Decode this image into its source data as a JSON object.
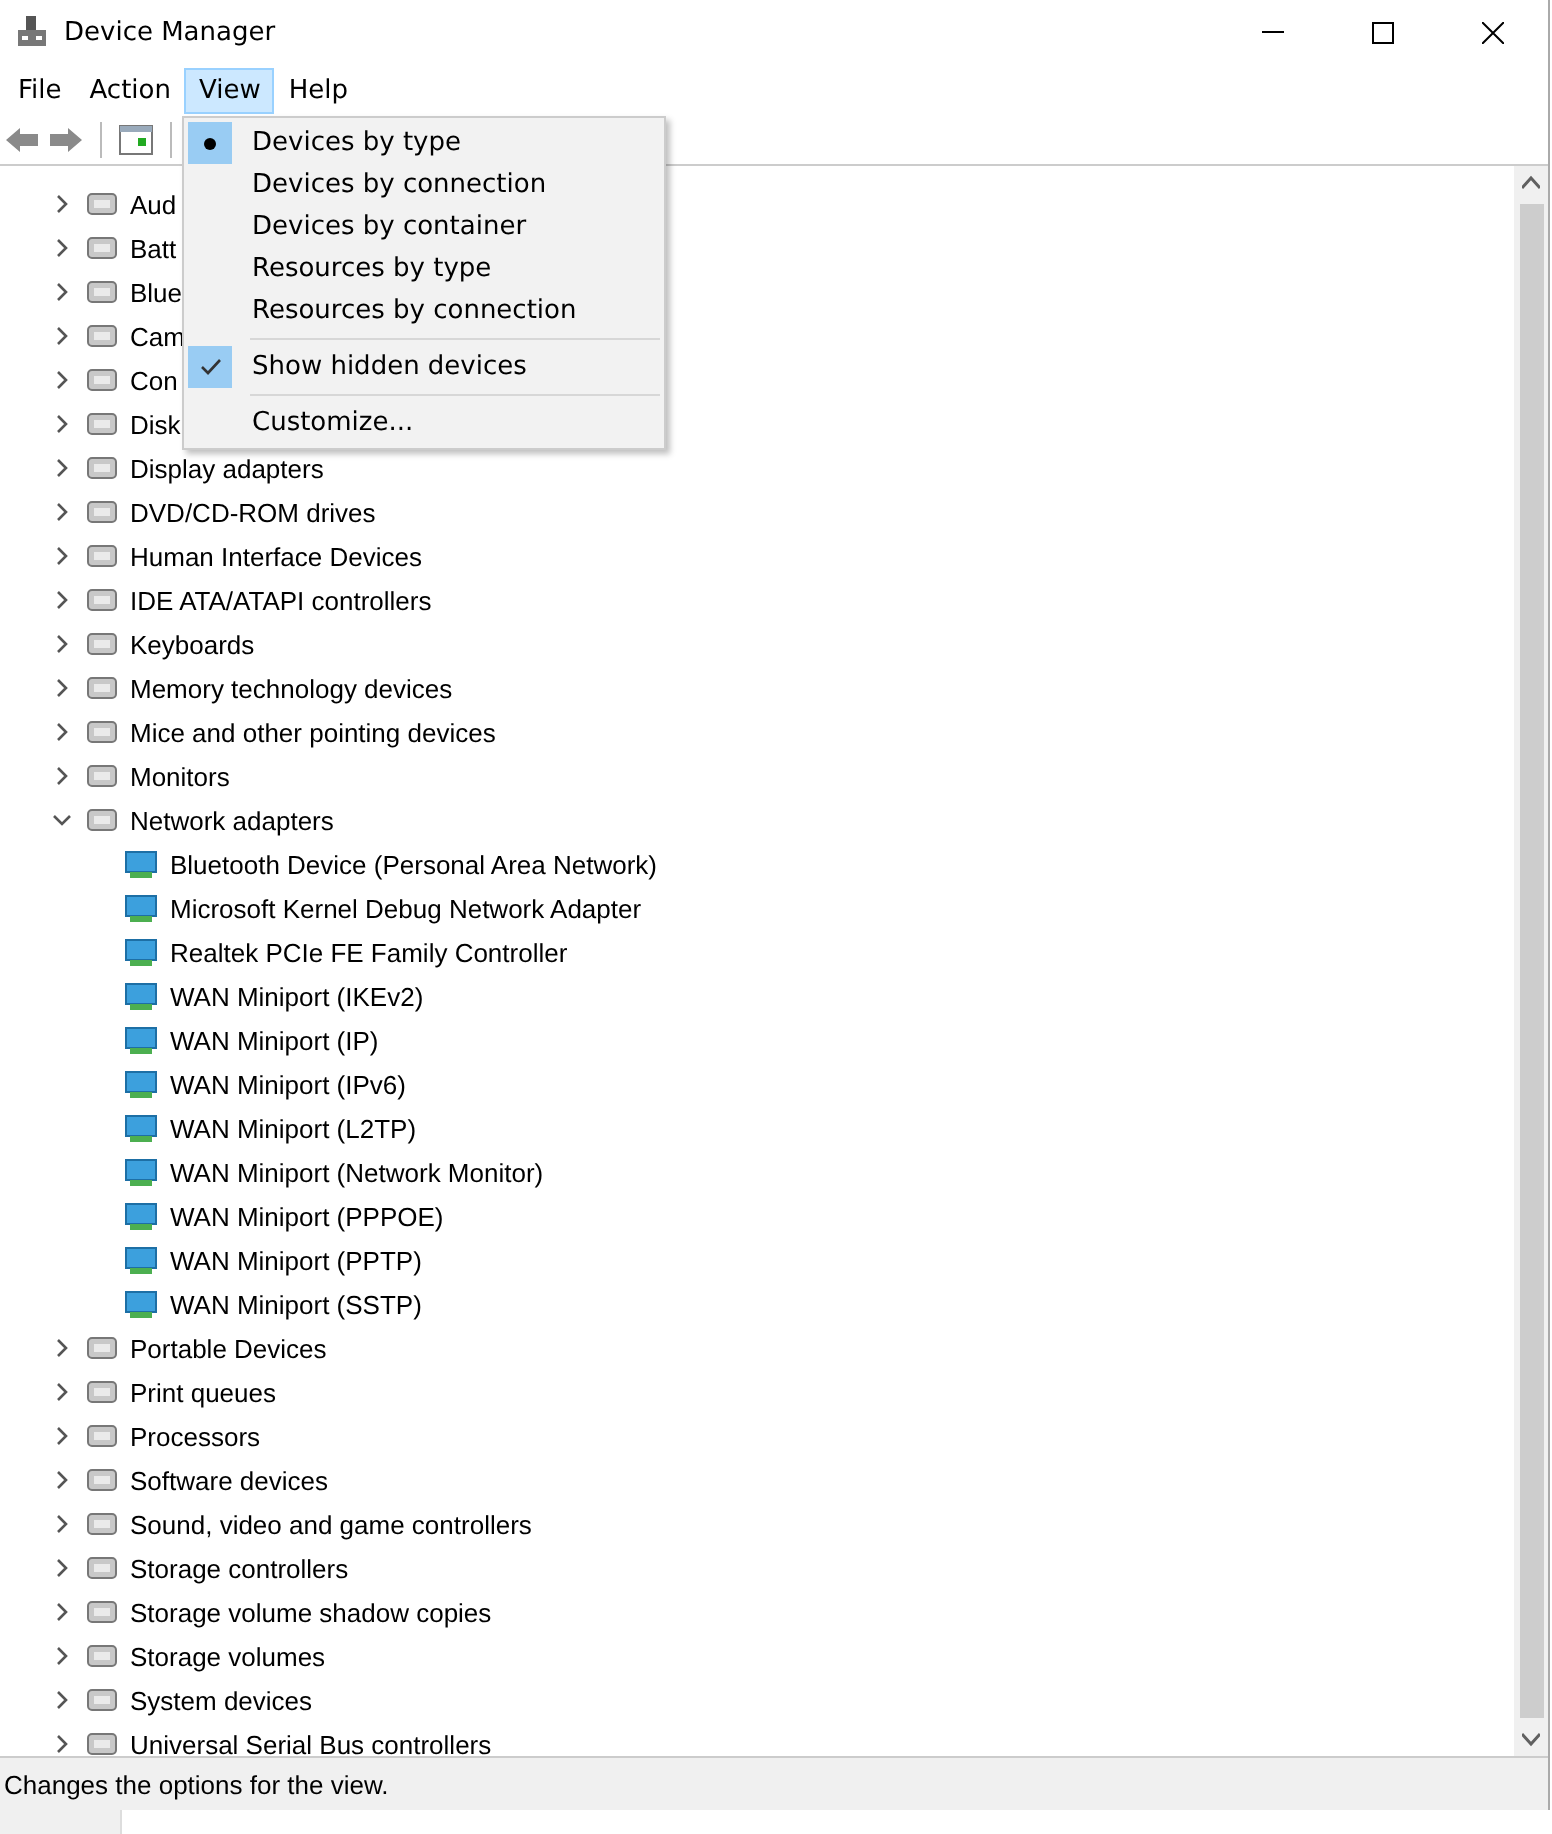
{
  "window": {
    "title": "Device Manager"
  },
  "menu_bar": [
    {
      "label": "File",
      "selected": false
    },
    {
      "label": "Action",
      "selected": false
    },
    {
      "label": "View",
      "selected": true
    },
    {
      "label": "Help",
      "selected": false
    }
  ],
  "view_menu": [
    {
      "kind": "radio",
      "label": "Devices by type",
      "checked": true
    },
    {
      "kind": "radio",
      "label": "Devices by connection",
      "checked": false
    },
    {
      "kind": "radio",
      "label": "Devices by container",
      "checked": false
    },
    {
      "kind": "radio",
      "label": "Resources by type",
      "checked": false
    },
    {
      "kind": "radio",
      "label": "Resources by connection",
      "checked": false
    },
    {
      "kind": "separator"
    },
    {
      "kind": "check",
      "label": "Show hidden devices",
      "checked": true
    },
    {
      "kind": "separator"
    },
    {
      "kind": "command",
      "label": "Customize..."
    }
  ],
  "tree": [
    {
      "label": "Aud",
      "expanded": false
    },
    {
      "label": "Batt",
      "expanded": false
    },
    {
      "label": "Blue",
      "expanded": false
    },
    {
      "label": "Cam",
      "expanded": false
    },
    {
      "label": "Con",
      "expanded": false
    },
    {
      "label": "Disk",
      "expanded": false
    },
    {
      "label": "Display adapters",
      "expanded": false
    },
    {
      "label": "DVD/CD-ROM drives",
      "expanded": false
    },
    {
      "label": "Human Interface Devices",
      "expanded": false
    },
    {
      "label": "IDE ATA/ATAPI controllers",
      "expanded": false
    },
    {
      "label": "Keyboards",
      "expanded": false
    },
    {
      "label": "Memory technology devices",
      "expanded": false
    },
    {
      "label": "Mice and other pointing devices",
      "expanded": false
    },
    {
      "label": "Monitors",
      "expanded": false
    },
    {
      "label": "Network adapters",
      "expanded": true,
      "children": [
        {
          "label": "Bluetooth Device (Personal Area Network)"
        },
        {
          "label": "Microsoft Kernel Debug Network Adapter"
        },
        {
          "label": "Realtek PCIe FE Family Controller"
        },
        {
          "label": "WAN Miniport (IKEv2)"
        },
        {
          "label": "WAN Miniport (IP)"
        },
        {
          "label": "WAN Miniport (IPv6)"
        },
        {
          "label": "WAN Miniport (L2TP)"
        },
        {
          "label": "WAN Miniport (Network Monitor)"
        },
        {
          "label": "WAN Miniport (PPPOE)"
        },
        {
          "label": "WAN Miniport (PPTP)"
        },
        {
          "label": "WAN Miniport (SSTP)"
        }
      ]
    },
    {
      "label": "Portable Devices",
      "expanded": false
    },
    {
      "label": "Print queues",
      "expanded": false
    },
    {
      "label": "Processors",
      "expanded": false
    },
    {
      "label": "Software devices",
      "expanded": false
    },
    {
      "label": "Sound, video and game controllers",
      "expanded": false
    },
    {
      "label": "Storage controllers",
      "expanded": false
    },
    {
      "label": "Storage volume shadow copies",
      "expanded": false
    },
    {
      "label": "Storage volumes",
      "expanded": false
    },
    {
      "label": "System devices",
      "expanded": false
    },
    {
      "label": "Universal Serial Bus controllers",
      "expanded": false
    }
  ],
  "status_bar": {
    "text": "Changes the options for the view."
  }
}
